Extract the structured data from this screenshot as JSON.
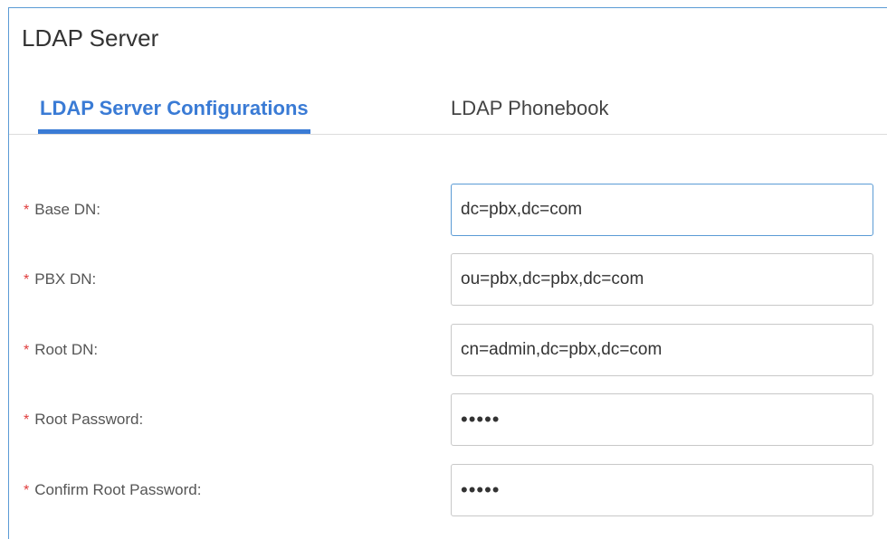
{
  "header": {
    "title": "LDAP Server"
  },
  "tabs": [
    {
      "label": "LDAP Server Configurations",
      "active": true
    },
    {
      "label": "LDAP Phonebook",
      "active": false
    }
  ],
  "form": {
    "required_marker": "*",
    "fields": [
      {
        "label": "Base DN:",
        "value": "dc=pbx,dc=com",
        "type": "text"
      },
      {
        "label": "PBX DN:",
        "value": "ou=pbx,dc=pbx,dc=com",
        "type": "text"
      },
      {
        "label": "Root DN:",
        "value": "cn=admin,dc=pbx,dc=com",
        "type": "text"
      },
      {
        "label": "Root Password:",
        "value": "•••••",
        "type": "password"
      },
      {
        "label": "Confirm Root Password:",
        "value": "•••••",
        "type": "password"
      }
    ]
  },
  "colors": {
    "accent": "#3a7bd5",
    "required": "#e03c3c",
    "frame_border": "#5b9bd5"
  }
}
